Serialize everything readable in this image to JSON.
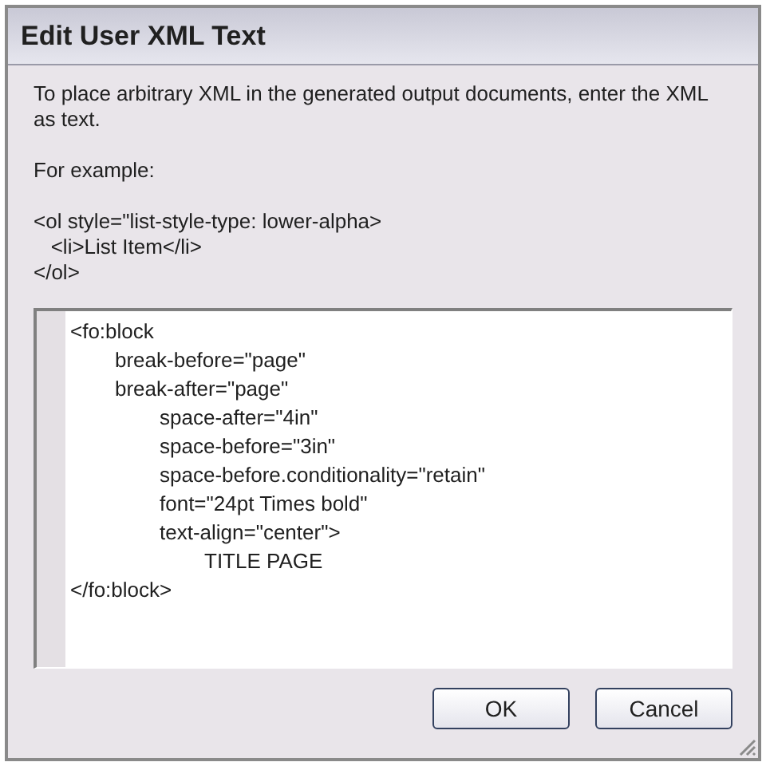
{
  "window": {
    "title": "Edit User XML Text"
  },
  "instructions": "To place arbitrary XML in the generated output documents, enter the XML as text.",
  "example_label": "For example:",
  "example": "<ol style=\"list-style-type: lower-alpha>\n   <li>List Item</li>\n</ol>",
  "editor": {
    "value": "<fo:block\n\tbreak-before=\"page\"\n\tbreak-after=\"page\"\n\t\tspace-after=\"4in\"\n\t\tspace-before=\"3in\"\n\t\tspace-before.conditionality=\"retain\"\n\t\tfont=\"24pt Times bold\"\n\t\ttext-align=\"center\">\n\t\t\tTITLE PAGE\n</fo:block>"
  },
  "buttons": [
    "OK",
    "Cancel"
  ]
}
